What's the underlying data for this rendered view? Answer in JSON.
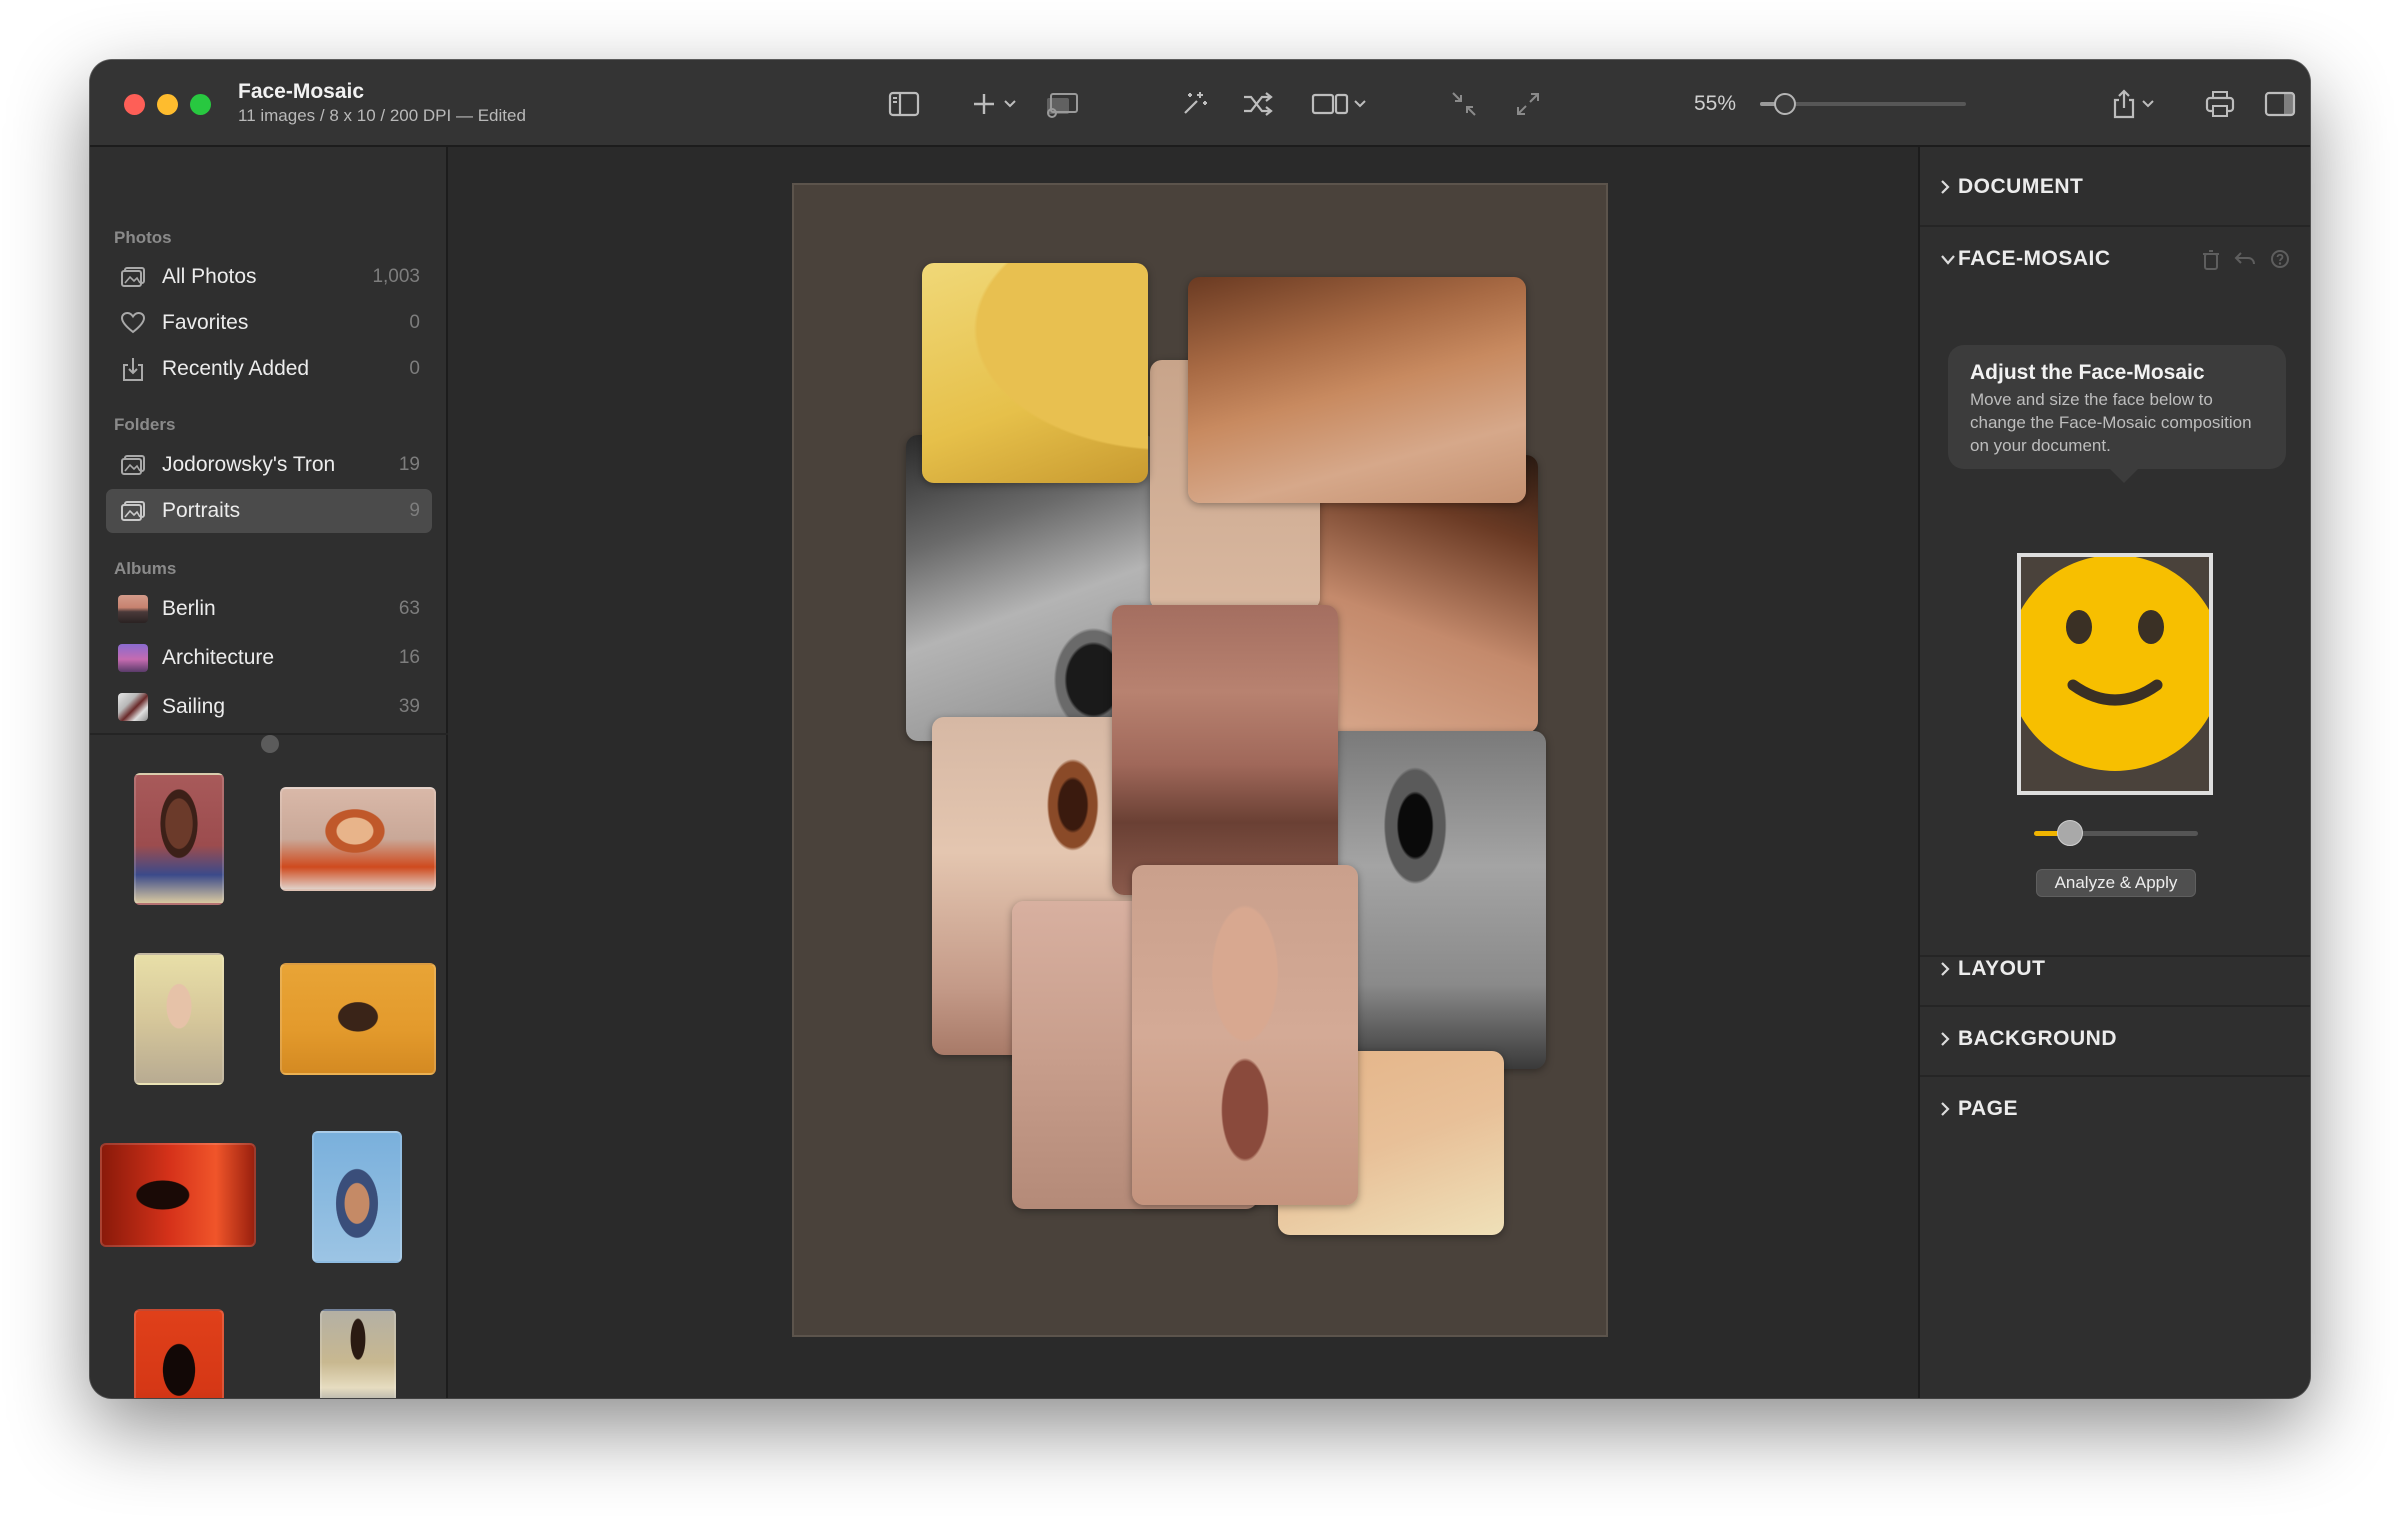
{
  "window": {
    "title": "Face-Mosaic",
    "subtitle": "11 images / 8 x 10 / 200 DPI — Edited"
  },
  "toolbar": {
    "icons": [
      "sidebar-toggle-icon",
      "add-icon",
      "chevron-down-icon",
      "slideshow-icon",
      "magic-wand-icon",
      "shuffle-icon",
      "layout-icon",
      "chevron-down-icon",
      "shrink-icon",
      "expand-icon",
      "share-icon",
      "chevron-down-icon",
      "print-icon",
      "inspector-toggle-icon"
    ],
    "zoom_label": "55%",
    "zoom_level": 0.12
  },
  "sidebar": {
    "sections": [
      {
        "header": "Photos",
        "items": [
          {
            "label": "All Photos",
            "count": "1,003",
            "icon": "photos-icon"
          },
          {
            "label": "Favorites",
            "count": "0",
            "icon": "heart-icon"
          },
          {
            "label": "Recently Added",
            "count": "0",
            "icon": "import-icon"
          }
        ]
      },
      {
        "header": "Folders",
        "items": [
          {
            "label": "Jodorowsky's Tron",
            "count": "19",
            "icon": "folder-photos-icon"
          },
          {
            "label": "Portraits",
            "count": "9",
            "icon": "folder-photos-icon",
            "selected": true
          }
        ]
      },
      {
        "header": "Albums",
        "items": [
          {
            "label": "Berlin",
            "count": "63",
            "icon": "album-thumb"
          },
          {
            "label": "Architecture",
            "count": "16",
            "icon": "album-thumb"
          },
          {
            "label": "Sailing",
            "count": "39",
            "icon": "album-thumb"
          }
        ]
      }
    ],
    "thumbnails": [
      "portrait-1",
      "portrait-2",
      "portrait-3",
      "portrait-4",
      "portrait-5",
      "portrait-6",
      "portrait-7",
      "portrait-8"
    ]
  },
  "inspector": {
    "sections": {
      "document": "DOCUMENT",
      "face_mosaic": "FACE-MOSAIC",
      "layout": "LAYOUT",
      "background": "BACKGROUND",
      "page": "PAGE"
    },
    "tooltip": {
      "title": "Adjust the Face-Mosaic",
      "body": "Move and size the face below to change the Face-Mosaic composition on your document."
    },
    "face_size_level": 0.22,
    "apply_button": "Analyze & Apply",
    "accent_color": "#f7bf00"
  }
}
